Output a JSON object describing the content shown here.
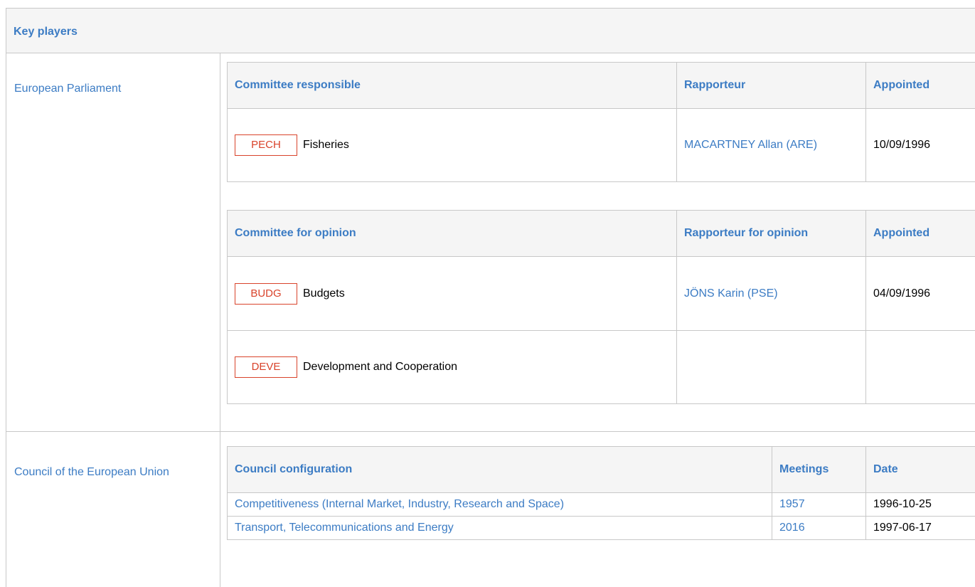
{
  "section_title": "Key players",
  "european_parliament": {
    "label": "European Parliament",
    "responsible": {
      "headers": {
        "committee": "Committee responsible",
        "rapporteur": "Rapporteur",
        "appointed": "Appointed"
      },
      "rows": [
        {
          "code": "PECH",
          "name": "Fisheries",
          "rapporteur": "MACARTNEY Allan (ARE)",
          "appointed": "10/09/1996"
        }
      ]
    },
    "opinion": {
      "headers": {
        "committee": "Committee for opinion",
        "rapporteur": "Rapporteur for opinion",
        "appointed": "Appointed"
      },
      "rows": [
        {
          "code": "BUDG",
          "name": "Budgets",
          "rapporteur": "JÖNS Karin (PSE)",
          "appointed": "04/09/1996"
        },
        {
          "code": "DEVE",
          "name": "Development and Cooperation",
          "rapporteur": "",
          "appointed": ""
        }
      ]
    }
  },
  "council": {
    "label": "Council of the European Union",
    "headers": {
      "configuration": "Council configuration",
      "meetings": "Meetings",
      "date": "Date"
    },
    "rows": [
      {
        "configuration": "Competitiveness (Internal Market, Industry, Research and Space)",
        "meeting": "1957",
        "date": "1996-10-25"
      },
      {
        "configuration": "Transport, Telecommunications and Energy",
        "meeting": "2016",
        "date": "1997-06-17"
      }
    ]
  },
  "colors": {
    "link": "#3c7cc4",
    "badge": "#d9432b",
    "border": "#c8c8c8",
    "header_bg": "#f5f5f5"
  }
}
